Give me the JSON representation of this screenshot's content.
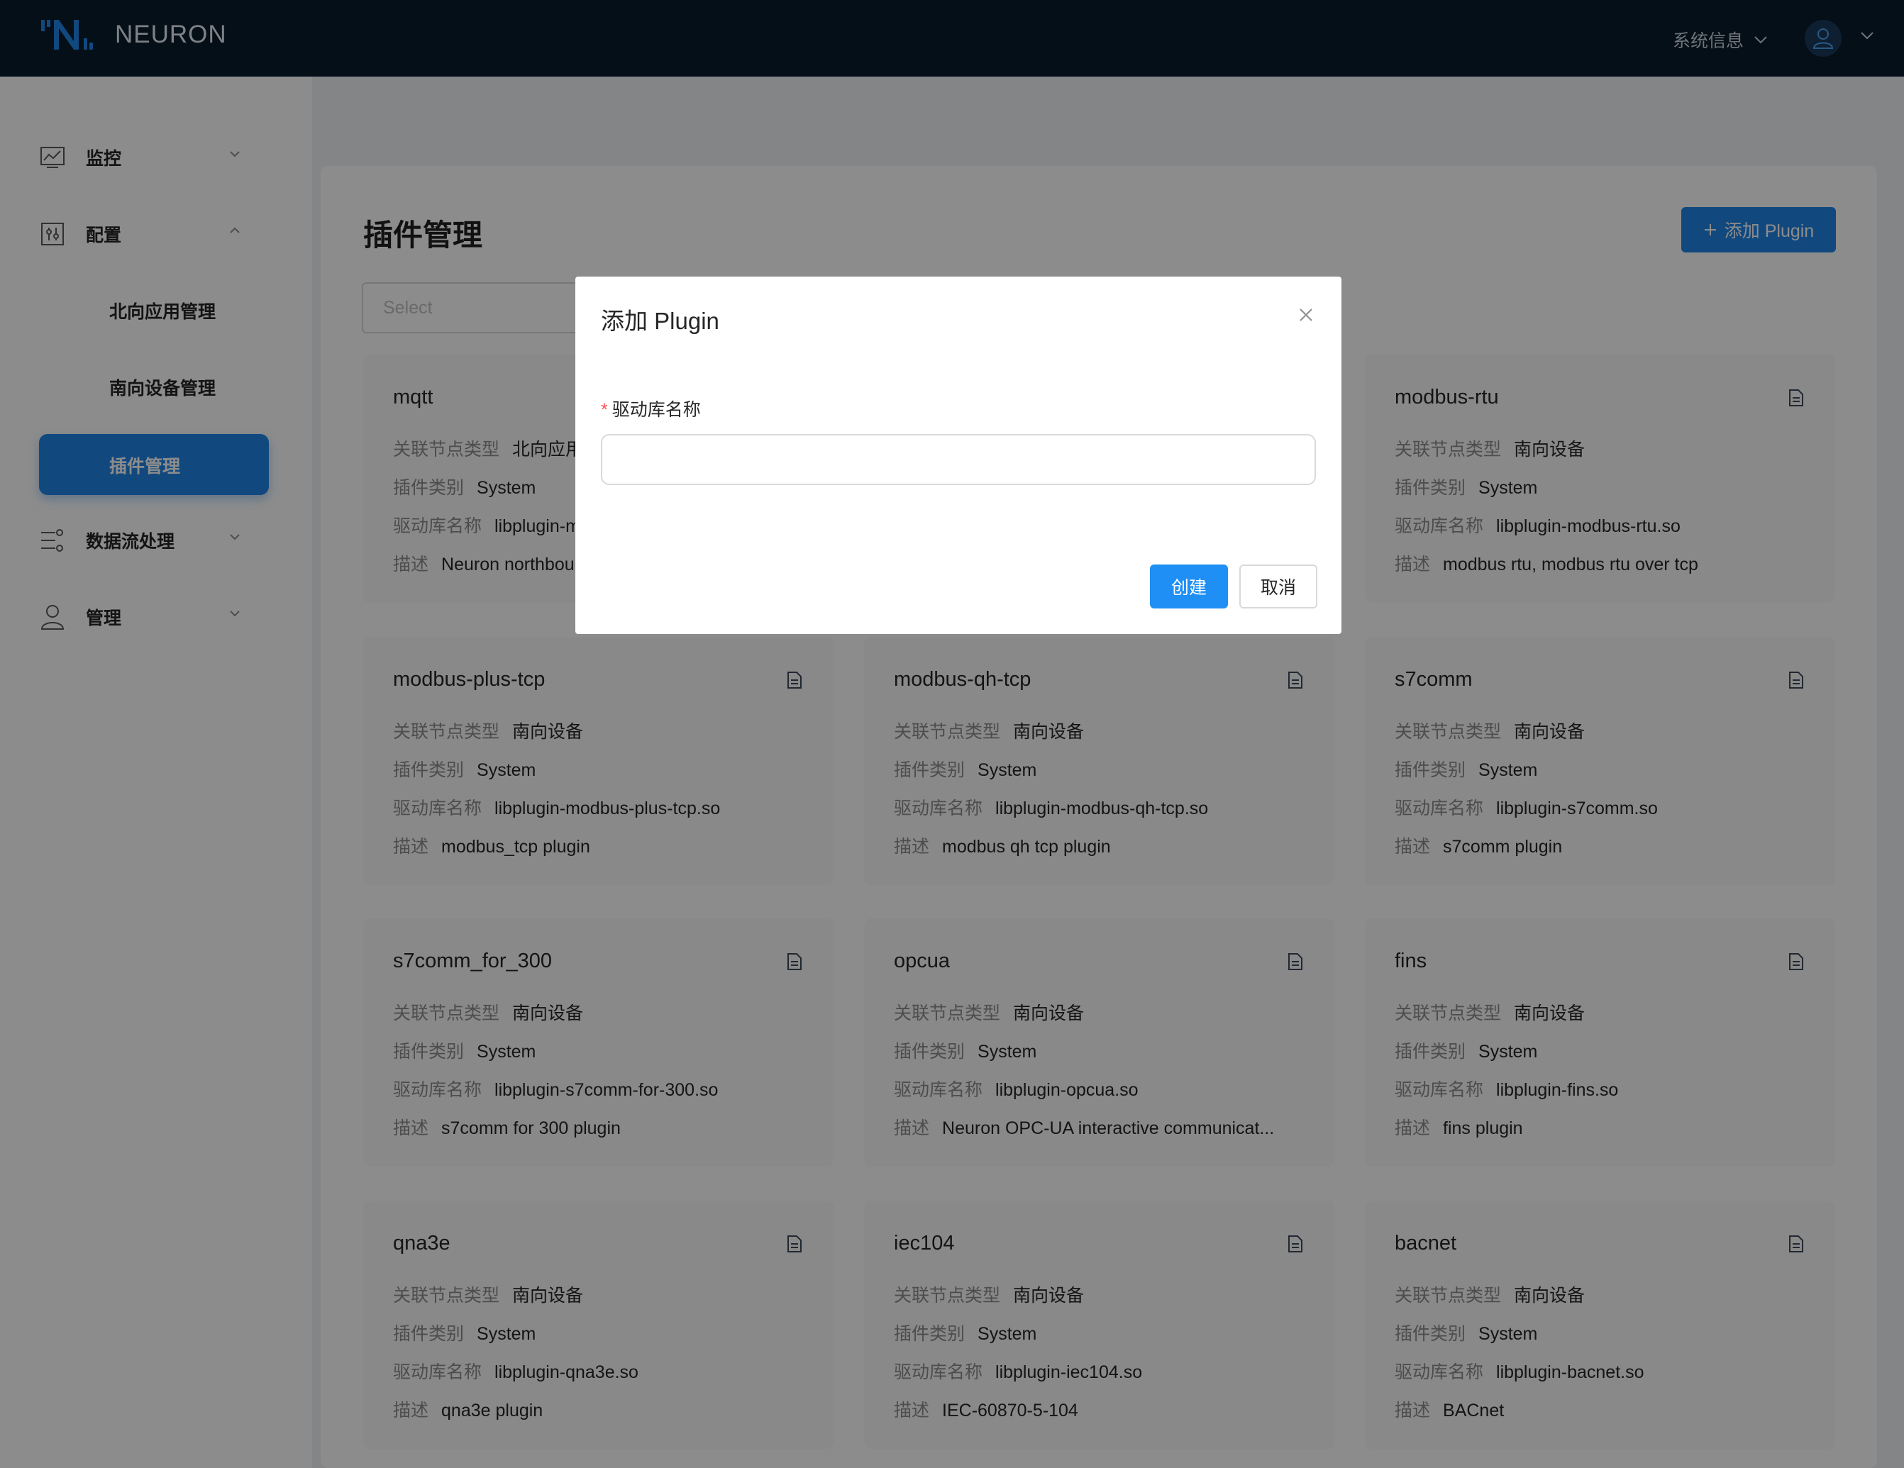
{
  "header": {
    "logo_text": "NEURON",
    "system_info": "系统信息"
  },
  "sidebar": {
    "items": [
      {
        "label": "监控",
        "icon": "monitor-chart-icon"
      },
      {
        "label": "配置",
        "icon": "config-sliders-icon"
      },
      {
        "label": "数据流处理",
        "icon": "dataflow-icon"
      },
      {
        "label": "管理",
        "icon": "user-icon"
      }
    ],
    "submenu": [
      {
        "label": "北向应用管理"
      },
      {
        "label": "南向设备管理"
      },
      {
        "label": "插件管理",
        "active": true
      }
    ]
  },
  "main": {
    "title": "插件管理",
    "add_button": "添加 Plugin",
    "select_placeholder": "Select",
    "field_labels": {
      "node_type": "关联节点类型",
      "category": "插件类别",
      "library": "驱动库名称",
      "description": "描述"
    },
    "cards": [
      {
        "name": "mqtt",
        "node_type": "北向应用",
        "category": "System",
        "library": "libplugin-mqtt.so",
        "description": "Neuron northbound MQTT plugin"
      },
      {
        "name": "",
        "node_type": "",
        "category": "",
        "library": "",
        "description": ""
      },
      {
        "name": "modbus-rtu",
        "node_type": "南向设备",
        "category": "System",
        "library": "libplugin-modbus-rtu.so",
        "description": "modbus rtu, modbus rtu over tcp"
      },
      {
        "name": "modbus-plus-tcp",
        "node_type": "南向设备",
        "category": "System",
        "library": "libplugin-modbus-plus-tcp.so",
        "description": "modbus_tcp plugin"
      },
      {
        "name": "modbus-qh-tcp",
        "node_type": "南向设备",
        "category": "System",
        "library": "libplugin-modbus-qh-tcp.so",
        "description": "modbus qh tcp plugin"
      },
      {
        "name": "s7comm",
        "node_type": "南向设备",
        "category": "System",
        "library": "libplugin-s7comm.so",
        "description": "s7comm plugin"
      },
      {
        "name": "s7comm_for_300",
        "node_type": "南向设备",
        "category": "System",
        "library": "libplugin-s7comm-for-300.so",
        "description": "s7comm for 300 plugin"
      },
      {
        "name": "opcua",
        "node_type": "南向设备",
        "category": "System",
        "library": "libplugin-opcua.so",
        "description": "Neuron OPC-UA interactive communicat..."
      },
      {
        "name": "fins",
        "node_type": "南向设备",
        "category": "System",
        "library": "libplugin-fins.so",
        "description": "fins plugin"
      },
      {
        "name": "qna3e",
        "node_type": "南向设备",
        "category": "System",
        "library": "libplugin-qna3e.so",
        "description": "qna3e plugin"
      },
      {
        "name": "iec104",
        "node_type": "南向设备",
        "category": "System",
        "library": "libplugin-iec104.so",
        "description": "IEC-60870-5-104"
      },
      {
        "name": "bacnet",
        "node_type": "南向设备",
        "category": "System",
        "library": "libplugin-bacnet.so",
        "description": "BACnet"
      }
    ]
  },
  "modal": {
    "title": "添加 Plugin",
    "field_label": "驱动库名称",
    "required_mark": "*",
    "input_value": "",
    "create_button": "创建",
    "cancel_button": "取消"
  },
  "colors": {
    "header_bg": "#0a1c2c",
    "primary": "#1f85e8",
    "overlay": "rgba(0,0,0,0.45)"
  }
}
